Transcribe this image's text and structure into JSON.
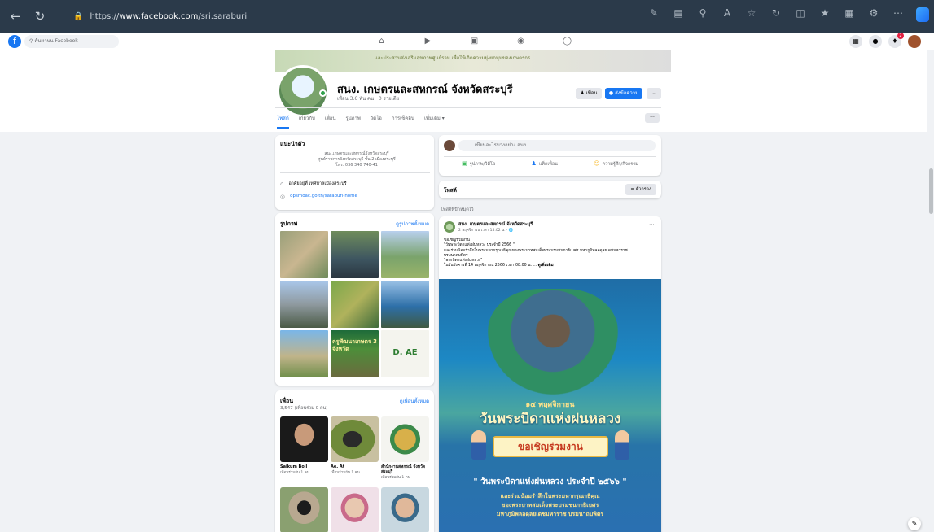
{
  "browser": {
    "back_icon": "back-arrow-icon",
    "refresh_icon": "refresh-icon",
    "url_prefix": "https://",
    "url_host": "www.facebook.com",
    "url_path": "/sri.saraburi",
    "toolbar_icons": [
      "read-aloud-icon",
      "immersive-reader-icon",
      "zoom-icon",
      "text-size-icon",
      "favorite-star-icon",
      "refresh-page-icon",
      "split-screen-icon",
      "favorites-icon",
      "collections-icon",
      "extensions-icon",
      "more-icon",
      "copilot-icon"
    ]
  },
  "fb": {
    "search_placeholder": "ค้นหาบน Facebook",
    "nav_icons": [
      "home-icon",
      "video-icon",
      "marketplace-icon",
      "groups-icon",
      "gaming-icon"
    ],
    "right_icons": [
      "menu-grid-icon",
      "messenger-icon",
      "notifications-icon"
    ],
    "notif_count": "2"
  },
  "page": {
    "cover_text": "และประสานส่งเสริมสุขภาพศูนย์รวม เพื่อให้เกิดความยุ่งยกมุมของเกษตรกร",
    "name": "สนง. เกษตรและสหกรณ์ จังหวัดสระบุรี",
    "meta": "เพื่อน 3.6 พัน คน · 0 รายเดีย",
    "follow_label": "เพื่อน",
    "message_label": "ส่งข้อความ",
    "more_label": "⌄",
    "tabs": [
      "โพสต์",
      "เกี่ยวกับ",
      "เพื่อน",
      "รูปภาพ",
      "วิดีโอ",
      "การเช็คอิน",
      "เพิ่มเติม ▾"
    ],
    "tab_more": "···"
  },
  "intro": {
    "title": "แนะนำตัว",
    "bio_line1": "สนง.เกษตรและสหกรณ์จังหวัดสระบุรี",
    "bio_line2": "ศูนย์ราชการจังหวัดสระบุรี ชั้น 2 เมืองสระบุรี",
    "bio_line3": "โทร. 036 340 740-41",
    "location": "อาศัยอยู่ที่ เทศบาลเมืองสระบุรี",
    "website": "opsmoac.go.th/saraburi-home"
  },
  "photos": {
    "title": "รูปภาพ",
    "see_all": "ดูรูปภาพทั้งหมด",
    "tile_texts": [
      "",
      "",
      "",
      "",
      "",
      "",
      "",
      "ครูพัฒนาเกษตร 3 จังหวัด",
      "D.  AE"
    ]
  },
  "friends": {
    "title": "เพื่อน",
    "see_all": "ดูเพื่อนทั้งหมด",
    "count": "3,547 (เพื่อนร่วม 0 คน)",
    "items": [
      {
        "name": "Saikum Boll",
        "sub": "เพื่อนร่วมกัน 1 คน"
      },
      {
        "name": "Ae. At",
        "sub": "เพื่อนร่วมกัน 1 คน"
      },
      {
        "name": "สำนักงานสหกรณ์ จังหวัดสระบุรี",
        "sub": "เพื่อนร่วมกัน 1 คน"
      },
      {
        "name": "",
        "sub": ""
      },
      {
        "name": "",
        "sub": ""
      },
      {
        "name": "",
        "sub": ""
      }
    ]
  },
  "composer": {
    "placeholder": "เขียนอะไรบางอย่าง สนง ...",
    "photo_video": "รูปภาพ/วิดีโอ",
    "tag_people": "แท็กเพื่อน",
    "feeling": "ความรู้สึก/กิจกรรม"
  },
  "posts": {
    "title": "โพสต์",
    "filter": "ตัวกรอง",
    "pinned_label": "โพสต์ที่ปักหมุดไว้"
  },
  "post": {
    "author": "สนง. เกษตรและสหกรณ์ จังหวัดสระบุรี",
    "time": "2 พฤศจิกายน เวลา 15:02 น. · 🌐",
    "text_lines": [
      "ขอเชิญร่วมงาน",
      "\"วันพระบิดาแห่งฝนหลวง ประจำปี 2566 \"",
      "และร่วมน้อมรำลึกในพระมหากรุณาธิคุณของพระบาทสมเด็จพระบรมชนกาธิเบศร มหาภูมิพลอดุลยเดชมหาราช",
      "บรมนาถบพิตร",
      "\"พระบิดาแห่งฝนหลวง\"",
      "ในวันอังคารที่ 14 พฤศจิกายน 2566 เวลา 08.00 น. ..."
    ],
    "see_more": "ดูเพิ่มเติม",
    "poster_date": "๑๔ พฤศจิกายน",
    "poster_title": "วันพระบิดาแห่งฝนหลวง",
    "poster_invite": "ขอเชิญร่วมงาน",
    "poster_line": "\" วันพระบิดาแห่งฝนหลวง ประจำปี ๒๕๖๖ \"",
    "poster_sub1": "และร่วมน้อมรำลึกในพระมหากรุณาธิคุณ",
    "poster_sub2": "ของพระบาทสมเด็จพระบรมชนกาธิเบศร",
    "poster_sub3": "มหาภูมิพลอดุลยเดชมหาราช บรมนาถบพิตร"
  },
  "colors": {
    "fb_blue": "#1877f2",
    "online_green": "#31a24c",
    "page_bg": "#f0f2f5"
  }
}
